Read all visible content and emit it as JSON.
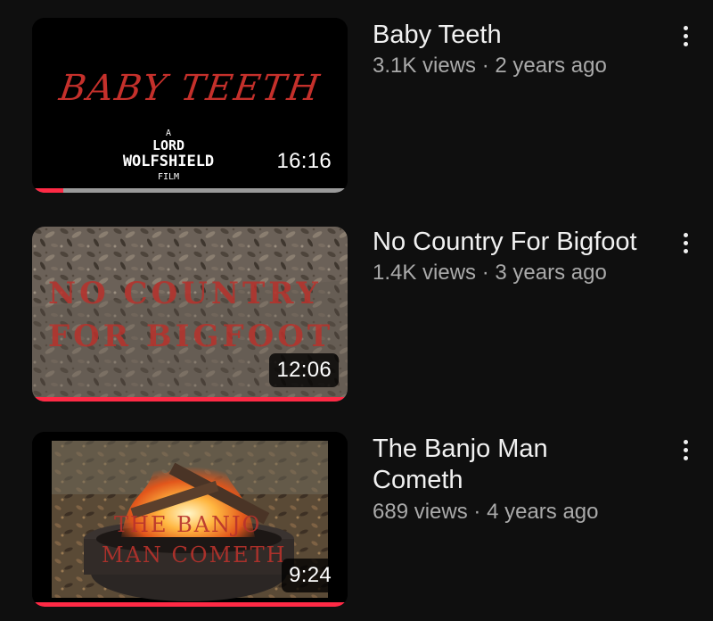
{
  "videos": [
    {
      "title": "Baby Teeth",
      "views": "3.1K views",
      "age": "2 years ago",
      "duration": "16:16",
      "progress": 0.1,
      "thumb_text": {
        "main": "BABY TEETH",
        "by_1": "A",
        "by_2": "LORD",
        "by_3": "WOLFSHIELD",
        "by_4": "FILM"
      }
    },
    {
      "title": "No Country For Bigfoot",
      "views": "1.4K views",
      "age": "3 years ago",
      "duration": "12:06",
      "progress": 1.0,
      "thumb_text": {
        "line1": "NO COUNTRY",
        "line2": "FOR BIGFOOT"
      }
    },
    {
      "title": "The Banjo Man Cometh",
      "views": "689 views",
      "age": "4 years ago",
      "duration": "9:24",
      "progress": 1.0,
      "thumb_text": {
        "line1": "THE BANJO",
        "line2": "MAN COMETH"
      }
    }
  ],
  "separator": "·",
  "colors": {
    "background": "#0f0f0f",
    "progress_fill": "#ff2a45",
    "progress_track": "#9a9a9a",
    "meta_text": "#aaaaaa",
    "thumb_title_red": "#c4302b"
  },
  "icons": {
    "more": "more-vert-icon"
  }
}
